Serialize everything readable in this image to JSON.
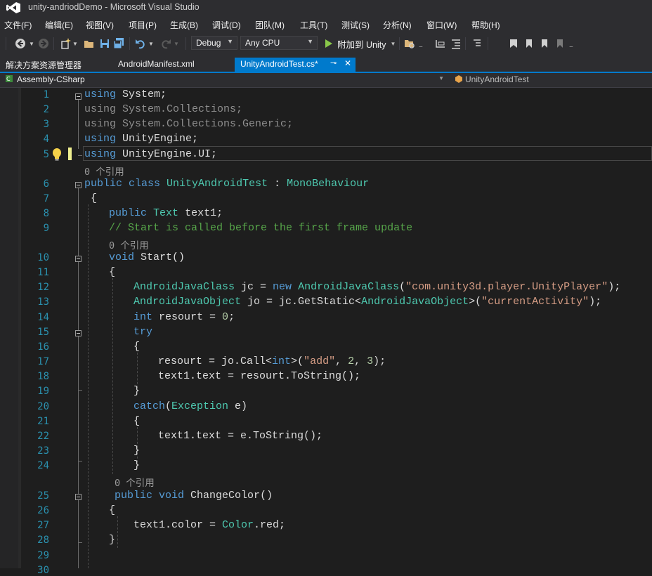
{
  "window": {
    "title": "unity-andriodDemo - Microsoft Visual Studio"
  },
  "menu": [
    "文件(F)",
    "编辑(E)",
    "视图(V)",
    "项目(P)",
    "生成(B)",
    "调试(D)",
    "团队(M)",
    "工具(T)",
    "测试(S)",
    "分析(N)",
    "窗口(W)",
    "帮助(H)"
  ],
  "toolbar": {
    "config": "Debug",
    "platform": "Any CPU",
    "attach_label": "附加到 Unity"
  },
  "tabs": {
    "solution_explorer": "解决方案资源管理器",
    "manifest": "AndroidManifest.xml",
    "active": "UnityAndroidTest.cs*"
  },
  "navbar": {
    "project": "Assembly-CSharp",
    "type": "UnityAndroidTest"
  },
  "code": {
    "line_numbers": [
      "1",
      "2",
      "3",
      "4",
      "5",
      "6",
      "7",
      "8",
      "9",
      "10",
      "11",
      "12",
      "13",
      "14",
      "15",
      "16",
      "17",
      "18",
      "19",
      "20",
      "21",
      "22",
      "23",
      "24",
      "25",
      "26",
      "27",
      "28",
      "29",
      "30"
    ],
    "ref_labels": [
      "0 个引用",
      "0 个引用",
      "0 个引用"
    ],
    "identifiers": {
      "class_name": "UnityAndroidTest",
      "base_class": "MonoBehaviour",
      "field": "text1",
      "method_start": "Start",
      "method_change": "ChangeColor",
      "java_player_class": "com.unity3d.player.UnityPlayer",
      "activity_field": "currentActivity",
      "call_method": "add"
    },
    "comment": "// Start is called before the first frame update"
  },
  "colors": {
    "keyword": "#569cd6",
    "type": "#4ec9b0",
    "string": "#d69d85",
    "comment": "#57a64a",
    "number": "#b5cea8",
    "line_number": "#2b91af",
    "accent": "#007acc",
    "vs_purple": "#865fc5"
  },
  "icons": [
    "visual-studio-logo-icon",
    "back-icon",
    "forward-icon",
    "new-project-icon",
    "open-folder-icon",
    "save-icon",
    "save-all-icon",
    "undo-icon",
    "redo-icon",
    "start-icon",
    "pin-icon",
    "close-icon",
    "lightbulb-icon",
    "bookmark-icon"
  ]
}
